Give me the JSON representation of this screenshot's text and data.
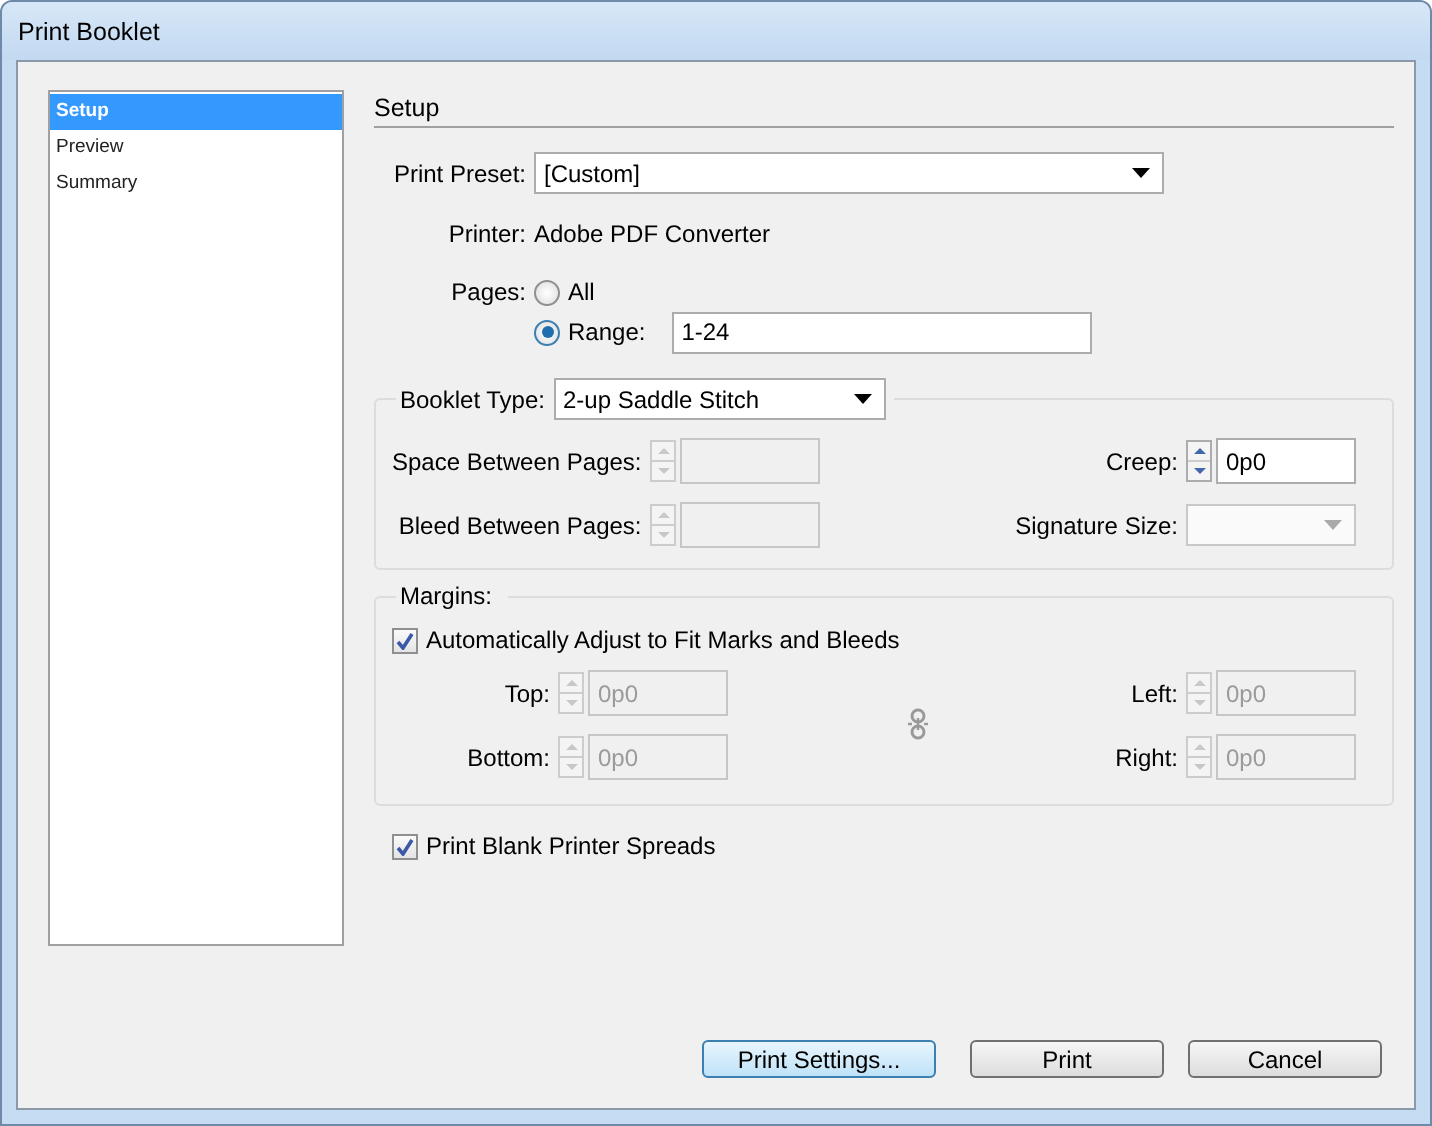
{
  "window": {
    "title": "Print Booklet"
  },
  "sidebar": {
    "items": [
      {
        "label": "Setup",
        "selected": true
      },
      {
        "label": "Preview",
        "selected": false
      },
      {
        "label": "Summary",
        "selected": false
      }
    ]
  },
  "section_title": "Setup",
  "print_preset": {
    "label": "Print Preset:",
    "value": "[Custom]"
  },
  "printer": {
    "label": "Printer:",
    "value": "Adobe PDF Converter"
  },
  "pages": {
    "label": "Pages:",
    "options": [
      {
        "label": "All",
        "selected": false
      },
      {
        "label": "Range:",
        "selected": true
      }
    ],
    "range_value": "1-24"
  },
  "booklet": {
    "label": "Booklet Type:",
    "value": "2-up Saddle Stitch",
    "fields": [
      {
        "kind": "spinner",
        "label": "Space Between Pages:",
        "disabled": true
      },
      {
        "kind": "spinner",
        "label": "Creep:",
        "value": "0p0",
        "disabled": false
      },
      {
        "kind": "spinner",
        "label": "Bleed Between Pages:",
        "disabled": true
      },
      {
        "kind": "dropdown",
        "label": "Signature Size:",
        "disabled": true
      }
    ]
  },
  "margins": {
    "title": "Margins:",
    "auto_adjust": {
      "label": "Automatically Adjust to Fit Marks and Bleeds",
      "checked": true
    },
    "fields": [
      {
        "label": "Top:",
        "value": "0p0",
        "disabled": true
      },
      {
        "label": "Left:",
        "value": "0p0",
        "disabled": true
      },
      {
        "label": "Bottom:",
        "value": "0p0",
        "disabled": true
      },
      {
        "label": "Right:",
        "value": "0p0",
        "disabled": true
      }
    ]
  },
  "print_blank": {
    "label": "Print Blank Printer Spreads",
    "checked": true
  },
  "buttons": [
    {
      "label": "Print Settings...",
      "default": true
    },
    {
      "label": "Print",
      "default": false
    },
    {
      "label": "Cancel",
      "default": false
    }
  ]
}
